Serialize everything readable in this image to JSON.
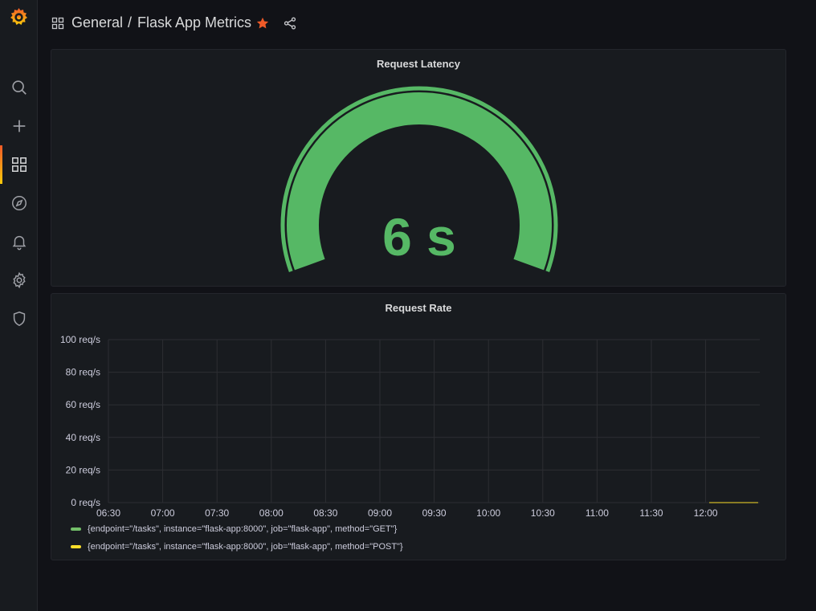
{
  "colors": {
    "accent": "#f05a28",
    "gauge_green": "#56b865",
    "series_get": "#73bf69",
    "series_post": "#fade2a"
  },
  "sidebar": {
    "items": [
      {
        "name": "search",
        "icon": "search-icon"
      },
      {
        "name": "create",
        "icon": "plus-icon"
      },
      {
        "name": "dashboards",
        "icon": "dashboards-icon",
        "active": true
      },
      {
        "name": "explore",
        "icon": "compass-icon"
      },
      {
        "name": "alerting",
        "icon": "bell-icon"
      },
      {
        "name": "configuration",
        "icon": "gear-icon"
      },
      {
        "name": "server-admin",
        "icon": "shield-icon"
      }
    ]
  },
  "header": {
    "folder": "General",
    "separator": "/",
    "title": "Flask App Metrics"
  },
  "panels": {
    "latency": {
      "title": "Request Latency",
      "value": "6 s",
      "gauge_fraction": 1.0
    },
    "rate": {
      "title": "Request Rate",
      "legend": [
        "{endpoint=\"/tasks\", instance=\"flask-app:8000\", job=\"flask-app\", method=\"GET\"}",
        "{endpoint=\"/tasks\", instance=\"flask-app:8000\", job=\"flask-app\", method=\"POST\"}"
      ]
    }
  },
  "chart_data": {
    "type": "line",
    "title": "Request Rate",
    "x_ticks": [
      "06:30",
      "07:00",
      "07:30",
      "08:00",
      "08:30",
      "09:00",
      "09:30",
      "10:00",
      "10:30",
      "11:00",
      "11:30",
      "12:00"
    ],
    "y_ticks": [
      "0 req/s",
      "20 req/s",
      "40 req/s",
      "60 req/s",
      "80 req/s",
      "100 req/s"
    ],
    "ylim": [
      0,
      100
    ],
    "grid": true,
    "legend_position": "bottom",
    "series": [
      {
        "name": "{endpoint=\"/tasks\", instance=\"flask-app:8000\", job=\"flask-app\", method=\"GET\"}",
        "x": [
          "12:02",
          "12:29"
        ],
        "values": [
          0,
          0
        ]
      },
      {
        "name": "{endpoint=\"/tasks\", instance=\"flask-app:8000\", job=\"flask-app\", method=\"POST\"}",
        "x": [
          "12:02",
          "12:29"
        ],
        "values": [
          0,
          0
        ]
      }
    ]
  }
}
